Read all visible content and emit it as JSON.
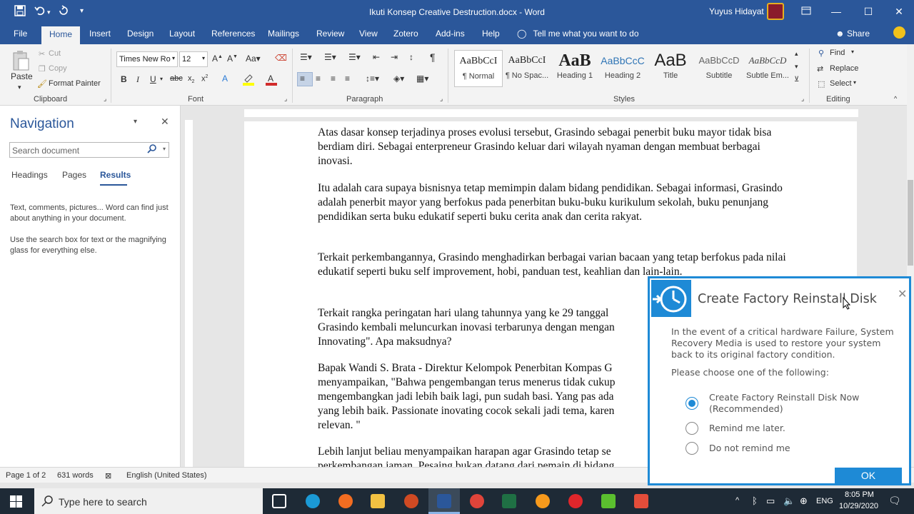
{
  "window": {
    "title": "Ikuti Konsep Creative Destruction.docx - Word",
    "user_name": "Yuyus Hidayat"
  },
  "menu_tabs": [
    {
      "label": "File"
    },
    {
      "label": "Home"
    },
    {
      "label": "Insert"
    },
    {
      "label": "Design"
    },
    {
      "label": "Layout"
    },
    {
      "label": "References"
    },
    {
      "label": "Mailings"
    },
    {
      "label": "Review"
    },
    {
      "label": "View"
    },
    {
      "label": "Zotero"
    },
    {
      "label": "Add-ins"
    },
    {
      "label": "Help"
    }
  ],
  "tell_me": "Tell me what you want to do",
  "share_label": "Share",
  "ribbon": {
    "clipboard": {
      "paste": "Paste",
      "cut": "Cut",
      "copy": "Copy",
      "format_painter": "Format Painter",
      "label": "Clipboard"
    },
    "font": {
      "name": "Times New Ro",
      "size": "12",
      "label": "Font"
    },
    "paragraph": {
      "label": "Paragraph"
    },
    "styles": {
      "label": "Styles",
      "items": [
        {
          "sample": "AaBbCcI",
          "name": "¶ Normal"
        },
        {
          "sample": "AaBbCcI",
          "name": "¶ No Spac..."
        },
        {
          "sample": "AaB",
          "name": "Heading 1"
        },
        {
          "sample": "AaBbCcC",
          "name": "Heading 2"
        },
        {
          "sample": "AaB",
          "name": "Title"
        },
        {
          "sample": "AaBbCcD",
          "name": "Subtitle"
        },
        {
          "sample": "AaBbCcD",
          "name": "Subtle Em..."
        }
      ]
    },
    "editing": {
      "find": "Find",
      "replace": "Replace",
      "select": "Select",
      "label": "Editing"
    }
  },
  "navigation": {
    "title": "Navigation",
    "search_placeholder": "Search document",
    "tabs": [
      {
        "label": "Headings"
      },
      {
        "label": "Pages"
      },
      {
        "label": "Results"
      }
    ],
    "help1": "Text, comments, pictures... Word can find just about anything in your document.",
    "help2": "Use the search box for text or the magnifying glass for everything else."
  },
  "document": {
    "paragraphs": [
      "Atas dasar konsep terjadinya proses evolusi tersebut, Grasindo sebagai penerbit buku mayor tidak bisa berdiam diri. Sebagai enterpreneur Grasindo keluar dari wilayah nyaman dengan membuat berbagai inovasi.",
      "Itu adalah cara supaya bisnisnya tetap memimpin dalam bidang pendidikan. Sebagai informasi, Grasindo adalah penerbit mayor yang berfokus pada penerbitan buku-buku kurikulum sekolah, buku penunjang pendidikan serta buku edukatif seperti buku cerita anak dan cerita rakyat.",
      "Terkait perkembangannya, Grasindo menghadirkan berbagai varian bacaan yang tetap berfokus pada nilai edukatif seperti buku self improvement, hobi, panduan test, keahlian dan lain-lain.",
      "Terkait rangka peringatan hari ulang tahunnya yang ke 29 tanggal",
      "Grasindo kembali meluncurkan inovasi terbarunya dengan mengan",
      "Innovating\".  Apa maksudnya?",
      "Bapak Wandi S. Brata - Direktur Kelompok Penerbitan Kompas G",
      "menyampaikan, \"Bahwa pengembangan terus menerus tidak cukup",
      "mengembangkan jadi lebih baik lagi, pun sudah basi. Yang pas ada",
      "yang lebih baik. Passionate inovating cocok sekali jadi tema, karen",
      "relevan. \"",
      "Lebih lanjut beliau menyampaikan harapan agar Grasindo tetap se",
      "perkembangan jaman. Pesaing bukan datang dari pemain di bidang"
    ]
  },
  "status": {
    "page": "Page 1 of 2",
    "words": "631 words",
    "language": "English (United States)"
  },
  "taskbar": {
    "search_placeholder": "Type here to search",
    "language": "ENG",
    "time": "8:05 PM",
    "date": "10/29/2020"
  },
  "dialog": {
    "title": "Create Factory Reinstall Disk",
    "body": "In the event of a critical hardware Failure, System Recovery Media is used to restore your system back to its original factory condition.",
    "prompt": "Please choose one of the following:",
    "options": [
      {
        "label": "Create Factory Reinstall Disk Now (Recommended)",
        "selected": true
      },
      {
        "label": "Remind me later.",
        "selected": false
      },
      {
        "label": "Do not remind me",
        "selected": false
      }
    ],
    "ok_label": "OK"
  },
  "colors": {
    "word_blue": "#2b579a",
    "dialog_blue": "#1e8ad6"
  }
}
